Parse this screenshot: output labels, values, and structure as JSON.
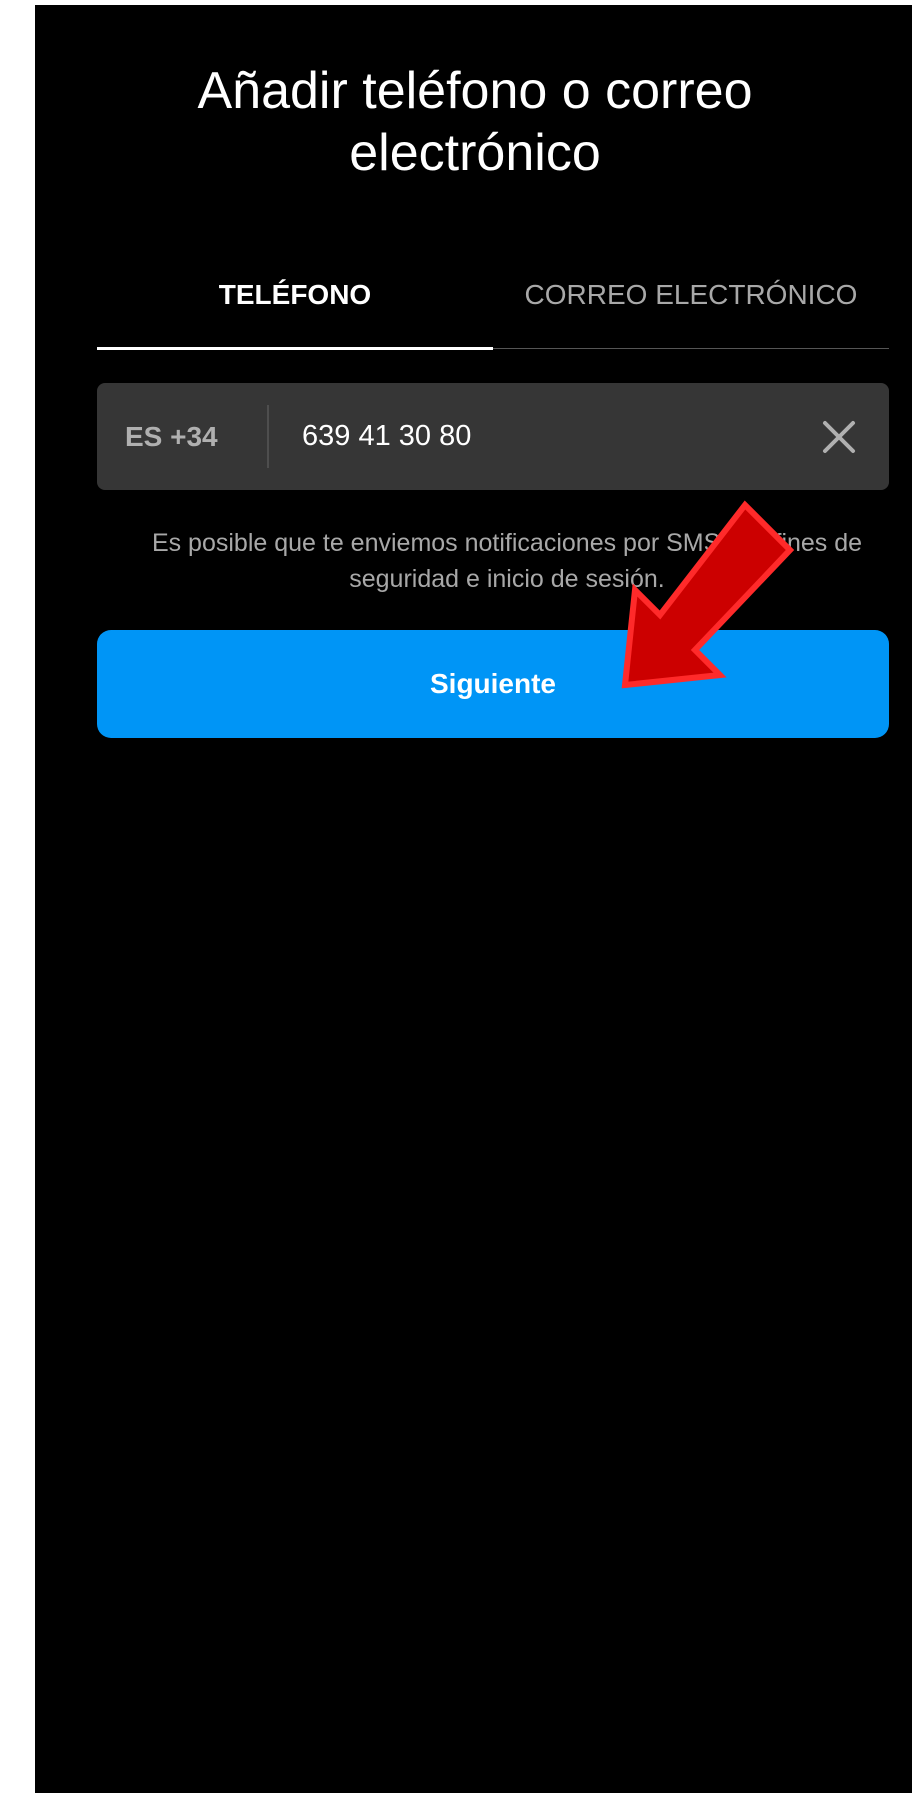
{
  "header": {
    "title": "Añadir teléfono o correo electrónico"
  },
  "tabs": [
    {
      "label": "TELÉFONO",
      "active": true
    },
    {
      "label": "CORREO ELECTRÓNICO",
      "active": false
    }
  ],
  "phone_field": {
    "country_code": "ES +34",
    "value": "639 41 30 80",
    "clear_icon": "close-icon"
  },
  "helper_text": "Es posible que te enviemos notificaciones por SMS con fines de seguridad e inicio de sesión.",
  "next_button": {
    "label": "Siguiente"
  },
  "annotation": {
    "icon": "red-arrow-icon",
    "color": "#cc0000"
  },
  "colors": {
    "background": "#000000",
    "field_background": "#363636",
    "accent": "#0095f6",
    "secondary_text": "#a8a8a8"
  }
}
